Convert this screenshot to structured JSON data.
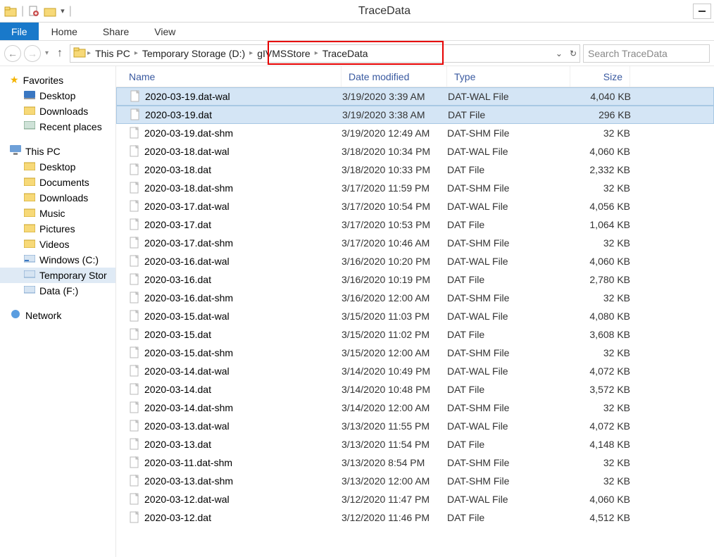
{
  "window_title": "TraceData",
  "ribbon": {
    "file": "File",
    "tabs": [
      "Home",
      "Share",
      "View"
    ]
  },
  "breadcrumbs": [
    "This PC",
    "Temporary Storage (D:)",
    "gIVMSStore",
    "TraceData"
  ],
  "search_placeholder": "Search TraceData",
  "columns": {
    "name": "Name",
    "date": "Date modified",
    "type": "Type",
    "size": "Size"
  },
  "sidebar": {
    "favorites": {
      "label": "Favorites",
      "items": [
        "Desktop",
        "Downloads",
        "Recent places"
      ]
    },
    "thispc": {
      "label": "This PC",
      "items": [
        "Desktop",
        "Documents",
        "Downloads",
        "Music",
        "Pictures",
        "Videos",
        "Windows (C:)",
        "Temporary Stor",
        "Data (F:)"
      ]
    },
    "network": {
      "label": "Network"
    }
  },
  "selected_indices": [
    0,
    1
  ],
  "files": [
    {
      "name": "2020-03-19.dat-wal",
      "date": "3/19/2020 3:39 AM",
      "type": "DAT-WAL File",
      "size": "4,040 KB"
    },
    {
      "name": "2020-03-19.dat",
      "date": "3/19/2020 3:38 AM",
      "type": "DAT File",
      "size": "296 KB"
    },
    {
      "name": "2020-03-19.dat-shm",
      "date": "3/19/2020 12:49 AM",
      "type": "DAT-SHM File",
      "size": "32 KB"
    },
    {
      "name": "2020-03-18.dat-wal",
      "date": "3/18/2020 10:34 PM",
      "type": "DAT-WAL File",
      "size": "4,060 KB"
    },
    {
      "name": "2020-03-18.dat",
      "date": "3/18/2020 10:33 PM",
      "type": "DAT File",
      "size": "2,332 KB"
    },
    {
      "name": "2020-03-18.dat-shm",
      "date": "3/17/2020 11:59 PM",
      "type": "DAT-SHM File",
      "size": "32 KB"
    },
    {
      "name": "2020-03-17.dat-wal",
      "date": "3/17/2020 10:54 PM",
      "type": "DAT-WAL File",
      "size": "4,056 KB"
    },
    {
      "name": "2020-03-17.dat",
      "date": "3/17/2020 10:53 PM",
      "type": "DAT File",
      "size": "1,064 KB"
    },
    {
      "name": "2020-03-17.dat-shm",
      "date": "3/17/2020 10:46 AM",
      "type": "DAT-SHM File",
      "size": "32 KB"
    },
    {
      "name": "2020-03-16.dat-wal",
      "date": "3/16/2020 10:20 PM",
      "type": "DAT-WAL File",
      "size": "4,060 KB"
    },
    {
      "name": "2020-03-16.dat",
      "date": "3/16/2020 10:19 PM",
      "type": "DAT File",
      "size": "2,780 KB"
    },
    {
      "name": "2020-03-16.dat-shm",
      "date": "3/16/2020 12:00 AM",
      "type": "DAT-SHM File",
      "size": "32 KB"
    },
    {
      "name": "2020-03-15.dat-wal",
      "date": "3/15/2020 11:03 PM",
      "type": "DAT-WAL File",
      "size": "4,080 KB"
    },
    {
      "name": "2020-03-15.dat",
      "date": "3/15/2020 11:02 PM",
      "type": "DAT File",
      "size": "3,608 KB"
    },
    {
      "name": "2020-03-15.dat-shm",
      "date": "3/15/2020 12:00 AM",
      "type": "DAT-SHM File",
      "size": "32 KB"
    },
    {
      "name": "2020-03-14.dat-wal",
      "date": "3/14/2020 10:49 PM",
      "type": "DAT-WAL File",
      "size": "4,072 KB"
    },
    {
      "name": "2020-03-14.dat",
      "date": "3/14/2020 10:48 PM",
      "type": "DAT File",
      "size": "3,572 KB"
    },
    {
      "name": "2020-03-14.dat-shm",
      "date": "3/14/2020 12:00 AM",
      "type": "DAT-SHM File",
      "size": "32 KB"
    },
    {
      "name": "2020-03-13.dat-wal",
      "date": "3/13/2020 11:55 PM",
      "type": "DAT-WAL File",
      "size": "4,072 KB"
    },
    {
      "name": "2020-03-13.dat",
      "date": "3/13/2020 11:54 PM",
      "type": "DAT File",
      "size": "4,148 KB"
    },
    {
      "name": "2020-03-11.dat-shm",
      "date": "3/13/2020 8:54 PM",
      "type": "DAT-SHM File",
      "size": "32 KB"
    },
    {
      "name": "2020-03-13.dat-shm",
      "date": "3/13/2020 12:00 AM",
      "type": "DAT-SHM File",
      "size": "32 KB"
    },
    {
      "name": "2020-03-12.dat-wal",
      "date": "3/12/2020 11:47 PM",
      "type": "DAT-WAL File",
      "size": "4,060 KB"
    },
    {
      "name": "2020-03-12.dat",
      "date": "3/12/2020 11:46 PM",
      "type": "DAT File",
      "size": "4,512 KB"
    }
  ]
}
